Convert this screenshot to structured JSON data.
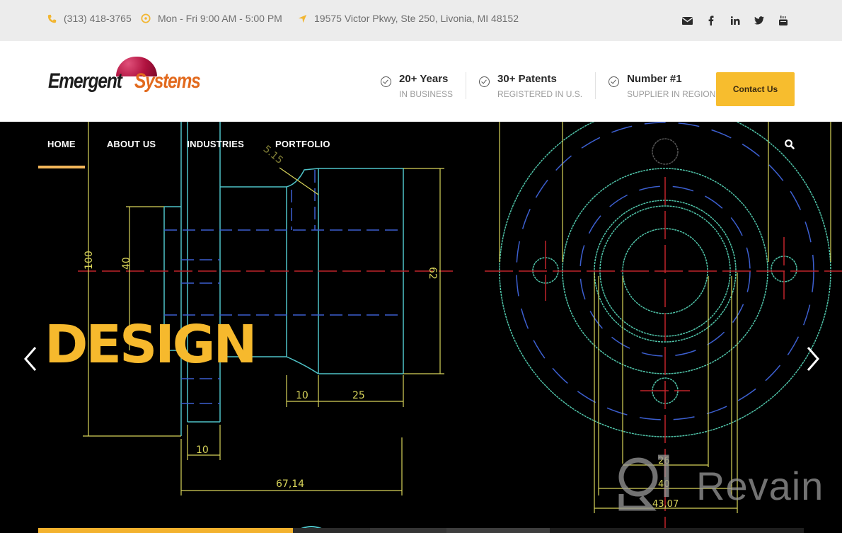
{
  "topbar": {
    "phone": "(313) 418-3765",
    "hours": "Mon - Fri 9:00 AM - 5:00 PM",
    "address": "19575 Victor Pkwy, Ste 250, Livonia, MI 48152",
    "icons": [
      "phone-icon",
      "clock-icon",
      "location-arrow-icon"
    ],
    "social": [
      {
        "name": "email-icon",
        "glyph": "✉"
      },
      {
        "name": "facebook-icon",
        "glyph": "f"
      },
      {
        "name": "linkedin-icon",
        "glyph": "in"
      },
      {
        "name": "twitter-icon",
        "glyph": "🐦"
      },
      {
        "name": "youtube-icon",
        "glyph": "▶"
      }
    ],
    "accent_color": "#f2b632"
  },
  "header": {
    "logo": {
      "word1": "Emergent",
      "word2": "Systems"
    },
    "stats": [
      {
        "title": "20+ Years",
        "subtitle": "IN BUSINESS"
      },
      {
        "title": "30+ Patents",
        "subtitle": "REGISTERED IN U.S."
      },
      {
        "title": "Number #1",
        "subtitle": "SUPPLIER IN REGION"
      }
    ],
    "contact_button": "Contact Us",
    "button_color": "#f7bd2e"
  },
  "nav": {
    "items": [
      {
        "label": "HOME",
        "active": true
      },
      {
        "label": "ABOUT US",
        "active": false
      },
      {
        "label": "INDUSTRIES",
        "active": false
      },
      {
        "label": "PORTFOLIO",
        "active": false
      }
    ]
  },
  "hero": {
    "headline": "DESIGN",
    "headline_color": "#f6b92d",
    "drawing_labels": {
      "dim_100": "100",
      "dim_40": "40",
      "dim_62": "62",
      "dim_10a": "10",
      "dim_25": "25",
      "dim_10b": "10",
      "dim_6714": "67,14",
      "dim_515": "5.15",
      "dim_26": "26",
      "dim_40b": "40",
      "dim_4307": "43,07"
    },
    "slide_progress": {
      "segments": [
        {
          "share": 0.333,
          "color": "#f3b22e"
        },
        {
          "share": 0.1,
          "color": "#2c2c2c"
        },
        {
          "share": 0.1,
          "color": "#353535"
        },
        {
          "share": 0.135,
          "color": "#3e3e3e"
        },
        {
          "share": 0.332,
          "color": "#1e1e1e"
        }
      ]
    }
  },
  "watermark": {
    "text": "Revain"
  }
}
